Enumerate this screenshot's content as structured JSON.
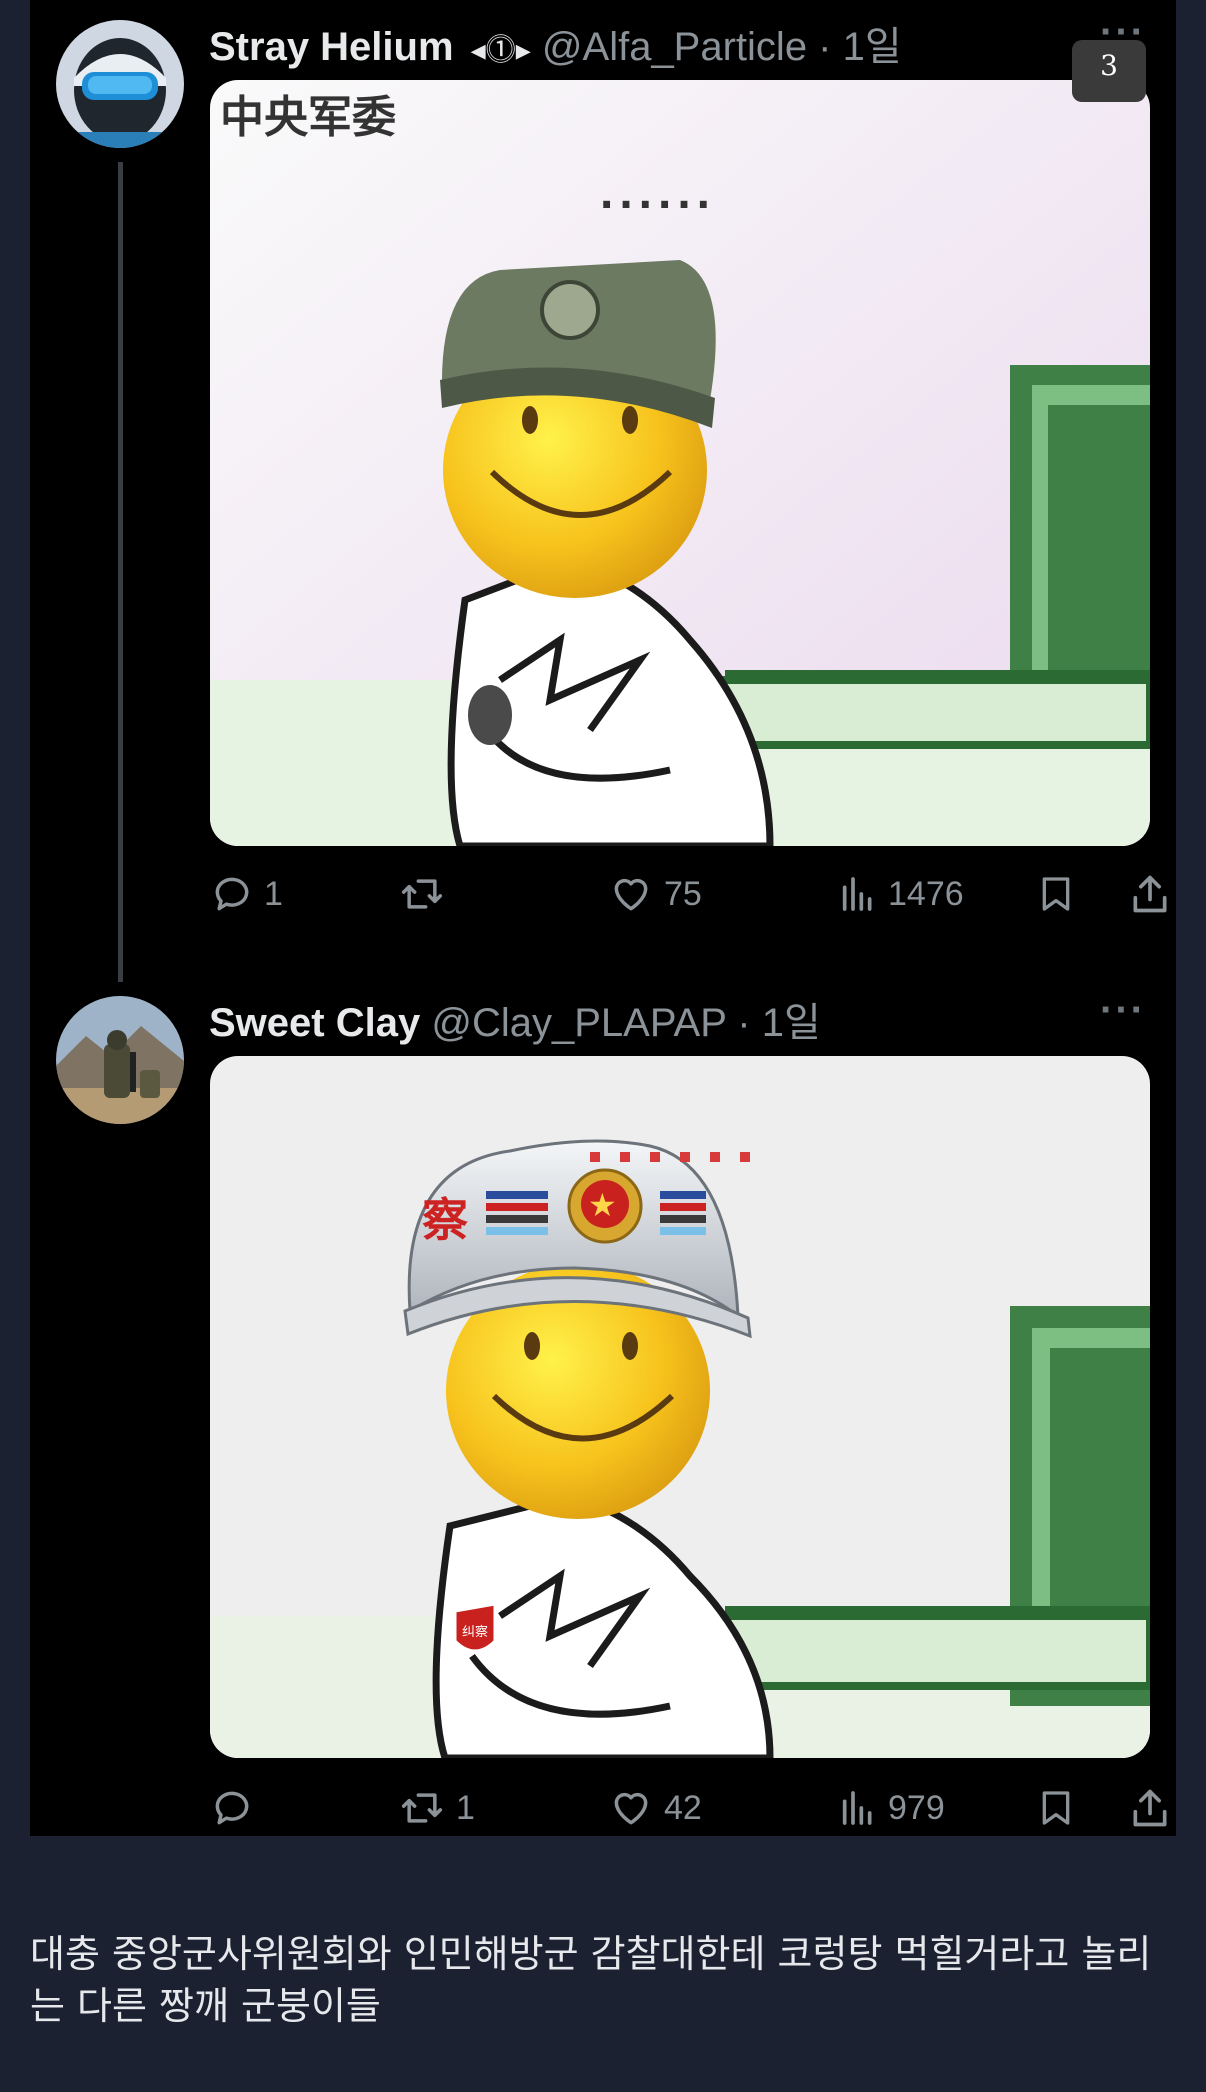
{
  "post1": {
    "name": "Stray Helium",
    "badge": "◂⓵▸",
    "handle": "@Alfa_Particle",
    "time": "1일",
    "more": "···",
    "page_badge": "3",
    "image_text": "中央军委",
    "dots": "......",
    "actions": {
      "replies": "1",
      "reposts": "",
      "likes": "75",
      "views": "1476"
    }
  },
  "post2": {
    "name": "Sweet Clay",
    "handle": "@Clay_PLAPAP",
    "time": "1일",
    "more": "···",
    "helmet_text": "察",
    "badge_text": "纠察",
    "actions": {
      "replies": "",
      "reposts": "1",
      "likes": "42",
      "views": "979"
    }
  },
  "caption": "대충 중앙군사위원회와 인민해방군 감찰대한테 코렁탕 먹힐거라고 놀리는 다른 짱깨 군붕이들",
  "colors": {
    "page_bg": "#1b2130",
    "tweet_bg": "#000000",
    "text": "#e7e9ea",
    "muted": "#8b9298"
  }
}
